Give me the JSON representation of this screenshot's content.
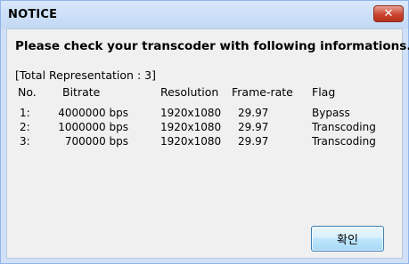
{
  "window": {
    "title": "NOTICE"
  },
  "dialog": {
    "heading": "Please check your transcoder with following informations.",
    "total": "[Total Representation : 3]",
    "columns": [
      "No.",
      "Bitrate",
      "Resolution",
      "Frame-rate",
      "Flag"
    ],
    "rows": [
      {
        "no": "1:",
        "bitrate": "4000000 bps",
        "resolution": "1920x1080",
        "framerate": "29.97",
        "flag": "Bypass"
      },
      {
        "no": "2:",
        "bitrate": "1000000 bps",
        "resolution": "1920x1080",
        "framerate": "29.97",
        "flag": "Transcoding"
      },
      {
        "no": "3:",
        "bitrate": "700000 bps",
        "resolution": "1920x1080",
        "framerate": "29.97",
        "flag": "Transcoding"
      }
    ],
    "ok_label": "확인"
  },
  "colors": {
    "close_button": "#c9452f",
    "titlebar": "#cfe0f7",
    "ok_border": "#3c7fb1"
  },
  "icons": {
    "close": "close-icon"
  }
}
